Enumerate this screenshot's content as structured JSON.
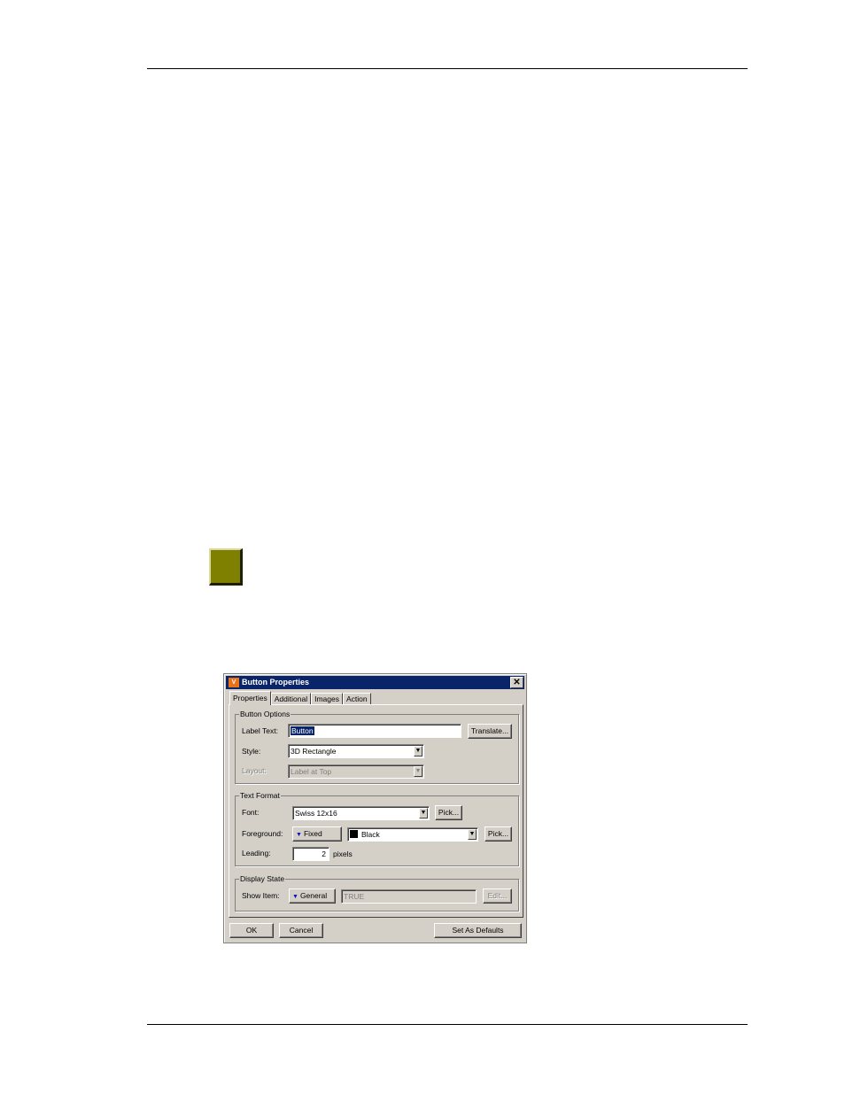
{
  "dialog": {
    "title": "Button Properties",
    "icon_text": "V",
    "close_glyph": "✕",
    "tabs": [
      "Properties",
      "Additional",
      "Images",
      "Action"
    ],
    "button_options": {
      "legend": "Button Options",
      "label_text_label": "Label Text:",
      "label_text_value": "Button",
      "translate_button": "Translate...",
      "style_label": "Style:",
      "style_value": "3D Rectangle",
      "layout_label": "Layout:",
      "layout_value": "Label at Top"
    },
    "text_format": {
      "legend": "Text Format",
      "font_label": "Font:",
      "font_value": "Swiss 12x16",
      "font_pick_button": "Pick...",
      "foreground_label": "Foreground:",
      "foreground_mode": "Fixed",
      "foreground_color": "Black",
      "foreground_pick_button": "Pick...",
      "leading_label": "Leading:",
      "leading_value": "2",
      "leading_unit": "pixels"
    },
    "display_state": {
      "legend": "Display State",
      "show_item_label": "Show Item:",
      "show_item_mode": "General",
      "show_item_value": "TRUE",
      "edit_button": "Edit..."
    },
    "footer": {
      "ok": "OK",
      "cancel": "Cancel",
      "set_defaults": "Set As Defaults"
    }
  },
  "colors": {
    "swatch": "#7f7f00",
    "dialog_face": "#d4d0c8",
    "title_bar": "#0a246a",
    "foreground_color_swatch": "#000000"
  },
  "icons": {
    "dropdown": "dropdown-arrow-icon",
    "mode_triangle": "triangle-down-icon",
    "close": "close-icon"
  }
}
